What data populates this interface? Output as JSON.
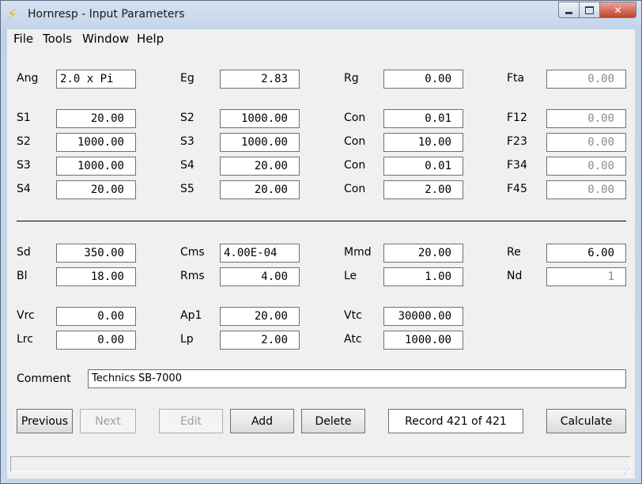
{
  "window": {
    "title": "Hornresp - Input Parameters"
  },
  "menu": [
    "File",
    "Tools",
    "Window",
    "Help"
  ],
  "row1": {
    "ang_label": "Ang",
    "ang_value": "2.0 x Pi",
    "eg_label": "Eg",
    "eg_value": "2.83",
    "rg_label": "Rg",
    "rg_value": "0.00",
    "fta_label": "Fta",
    "fta_value": "0.00"
  },
  "segments": [
    {
      "s_label": "S1",
      "s_value": "20.00",
      "s_next_label": "S2",
      "s_next_value": "1000.00",
      "con_label": "Con",
      "con_value": "0.01",
      "f_label": "F12",
      "f_value": "0.00"
    },
    {
      "s_label": "S2",
      "s_value": "1000.00",
      "s_next_label": "S3",
      "s_next_value": "1000.00",
      "con_label": "Con",
      "con_value": "10.00",
      "f_label": "F23",
      "f_value": "0.00"
    },
    {
      "s_label": "S3",
      "s_value": "1000.00",
      "s_next_label": "S4",
      "s_next_value": "20.00",
      "con_label": "Con",
      "con_value": "0.01",
      "f_label": "F34",
      "f_value": "0.00"
    },
    {
      "s_label": "S4",
      "s_value": "20.00",
      "s_next_label": "S5",
      "s_next_value": "20.00",
      "con_label": "Con",
      "con_value": "2.00",
      "f_label": "F45",
      "f_value": "0.00"
    }
  ],
  "driver": {
    "sd_label": "Sd",
    "sd_value": "350.00",
    "cms_label": "Cms",
    "cms_value": "4.00E-04",
    "mmd_label": "Mmd",
    "mmd_value": "20.00",
    "re_label": "Re",
    "re_value": "6.00",
    "bl_label": "Bl",
    "bl_value": "18.00",
    "rms_label": "Rms",
    "rms_value": "4.00",
    "le_label": "Le",
    "le_value": "1.00",
    "nd_label": "Nd",
    "nd_value": "1"
  },
  "chambers": {
    "vrc_label": "Vrc",
    "vrc_value": "0.00",
    "ap1_label": "Ap1",
    "ap1_value": "20.00",
    "vtc_label": "Vtc",
    "vtc_value": "30000.00",
    "lrc_label": "Lrc",
    "lrc_value": "0.00",
    "lp_label": "Lp",
    "lp_value": "2.00",
    "atc_label": "Atc",
    "atc_value": "1000.00"
  },
  "comment": {
    "label": "Comment",
    "value": "Technics SB-7000"
  },
  "buttons": {
    "previous": "Previous",
    "next": "Next",
    "edit": "Edit",
    "add": "Add",
    "delete": "Delete",
    "calculate": "Calculate"
  },
  "record": "Record 421 of 421",
  "status": ""
}
